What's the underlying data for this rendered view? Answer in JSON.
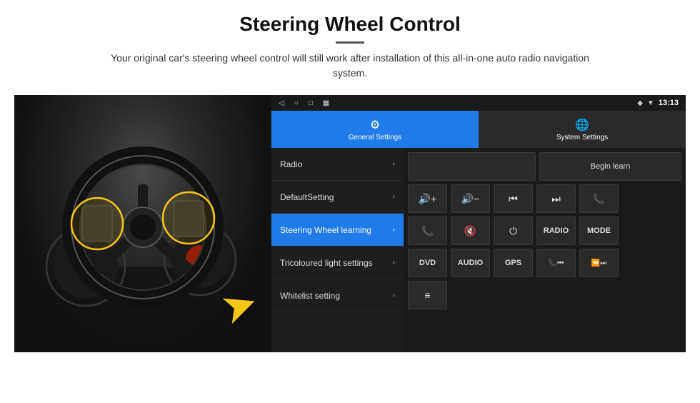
{
  "header": {
    "title": "Steering Wheel Control",
    "divider": true,
    "subtitle": "Your original car's steering wheel control will still work after installation of this all-in-one auto radio navigation system."
  },
  "status_bar": {
    "nav_icons": [
      "◁",
      "○",
      "□",
      "▦"
    ],
    "status_icons": [
      "♥",
      "▼"
    ],
    "time": "13:13"
  },
  "tabs": [
    {
      "label": "General Settings",
      "icon": "⚙",
      "active": true
    },
    {
      "label": "System Settings",
      "icon": "🌐",
      "active": false
    }
  ],
  "menu_items": [
    {
      "label": "Radio",
      "active": false
    },
    {
      "label": "DefaultSetting",
      "active": false
    },
    {
      "label": "Steering Wheel learning",
      "active": true
    },
    {
      "label": "Tricoloured light settings",
      "active": false
    },
    {
      "label": "Whitelist setting",
      "active": false
    }
  ],
  "grid": {
    "row1": {
      "empty_box": "",
      "begin_learn_label": "Begin learn"
    },
    "row2_icons": [
      "🔊+",
      "🔊-",
      "⏮",
      "⏭",
      "📞"
    ],
    "row3_icons": [
      "📞",
      "🔇",
      "⏻",
      "RADIO",
      "MODE"
    ],
    "row4_labels": [
      "DVD",
      "AUDIO",
      "GPS",
      "📞⏮",
      "⏪⏭"
    ],
    "row5_icon": "≡"
  }
}
